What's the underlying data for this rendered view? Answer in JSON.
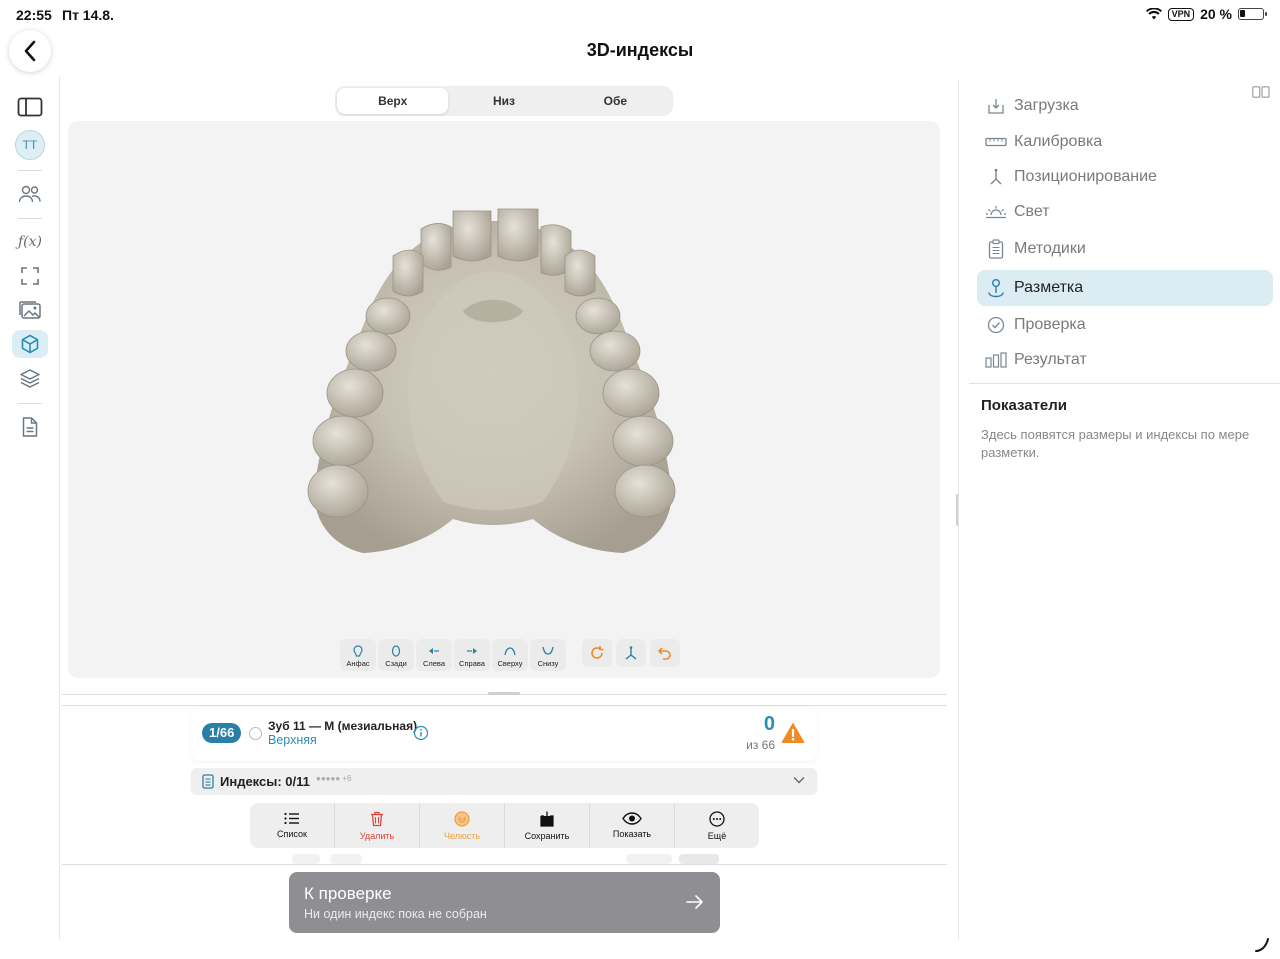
{
  "status_bar": {
    "time": "22:55",
    "date": "Пт 14.8.",
    "vpn": "VPN",
    "battery": "20 %"
  },
  "page": {
    "title": "3D-индексы"
  },
  "left_rail": {
    "avatar_initials": "ТТ"
  },
  "jaw_tabs": [
    {
      "label": "Верх",
      "active": true
    },
    {
      "label": "Низ",
      "active": false
    },
    {
      "label": "Обе",
      "active": false
    }
  ],
  "view_buttons": [
    {
      "label": "Анфас",
      "icon": "front-view-icon"
    },
    {
      "label": "Сзади",
      "icon": "back-view-icon"
    },
    {
      "label": "Слева",
      "icon": "left-view-icon"
    },
    {
      "label": "Справа",
      "icon": "right-view-icon"
    },
    {
      "label": "Сверху",
      "icon": "top-view-icon"
    },
    {
      "label": "Снизу",
      "icon": "bottom-view-icon"
    }
  ],
  "current_tooth": {
    "counter": "1/66",
    "name": "Зуб 11 — М (мезиальная)",
    "jaw": "Верхняя",
    "score": "0",
    "score_of": "из 66"
  },
  "indexes": {
    "label": "Индексы: 0/11",
    "dots": "●●●●● +6"
  },
  "actions": [
    {
      "label": "Список",
      "icon": "list-icon"
    },
    {
      "label": "Удалить",
      "icon": "trash-icon"
    },
    {
      "label": "Челюсть",
      "icon": "jaw-icon"
    },
    {
      "label": "Сохранить",
      "icon": "save-icon"
    },
    {
      "label": "Показать",
      "icon": "eye-icon"
    },
    {
      "label": "Ещё",
      "icon": "more-icon"
    }
  ],
  "cta": {
    "title": "К проверке",
    "subtitle": "Ни один индекс пока не собран"
  },
  "steps": [
    {
      "label": "Загрузка",
      "icon": "upload-icon"
    },
    {
      "label": "Калибровка",
      "icon": "ruler-icon"
    },
    {
      "label": "Позиционирование",
      "icon": "axis-icon"
    },
    {
      "label": "Свет",
      "icon": "light-icon"
    },
    {
      "label": "Методики",
      "icon": "clipboard-icon"
    },
    {
      "label": "Разметка",
      "icon": "marker-icon",
      "active": true
    },
    {
      "label": "Проверка",
      "icon": "check-circle-icon"
    },
    {
      "label": "Результат",
      "icon": "bars-icon"
    }
  ],
  "metrics": {
    "title": "Показатели",
    "hint": "Здесь появятся размеры и индексы по мере разметки."
  },
  "colors": {
    "accent": "#2a8fb5",
    "counter_pill": "#2a7fa8",
    "warning": "#f08a24",
    "delete": "#e0443a",
    "cta_bg": "#8e8e93"
  }
}
